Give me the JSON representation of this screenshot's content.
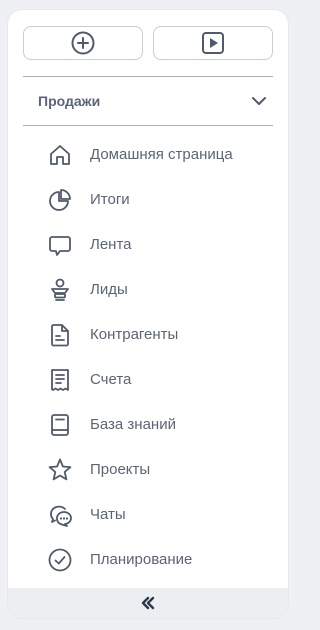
{
  "toolbar": {
    "add_icon": "plus-circle-icon",
    "play_icon": "play-square-icon"
  },
  "section": {
    "title": "Продажи",
    "toggle_icon": "chevron-down-icon"
  },
  "menu": {
    "items": [
      {
        "label": "Домашняя страница",
        "icon": "home-icon"
      },
      {
        "label": "Итоги",
        "icon": "pie-chart-icon"
      },
      {
        "label": "Лента",
        "icon": "chat-bubble-icon"
      },
      {
        "label": "Лиды",
        "icon": "person-stack-icon"
      },
      {
        "label": "Контрагенты",
        "icon": "document-icon"
      },
      {
        "label": "Счета",
        "icon": "receipt-icon"
      },
      {
        "label": "База знаний",
        "icon": "book-icon"
      },
      {
        "label": "Проекты",
        "icon": "star-icon"
      },
      {
        "label": "Чаты",
        "icon": "chats-icon"
      },
      {
        "label": "Планирование",
        "icon": "check-circle-icon"
      }
    ]
  },
  "footer": {
    "collapse_glyph": "«",
    "icon": "double-chevron-left-icon"
  },
  "colors": {
    "panel_bg": "#ffffff",
    "page_bg": "#eef0f3",
    "text": "#5b6577",
    "icon": "#4f5a6d",
    "divider": "#a9aeb6",
    "footer_bg": "#eceef1"
  }
}
